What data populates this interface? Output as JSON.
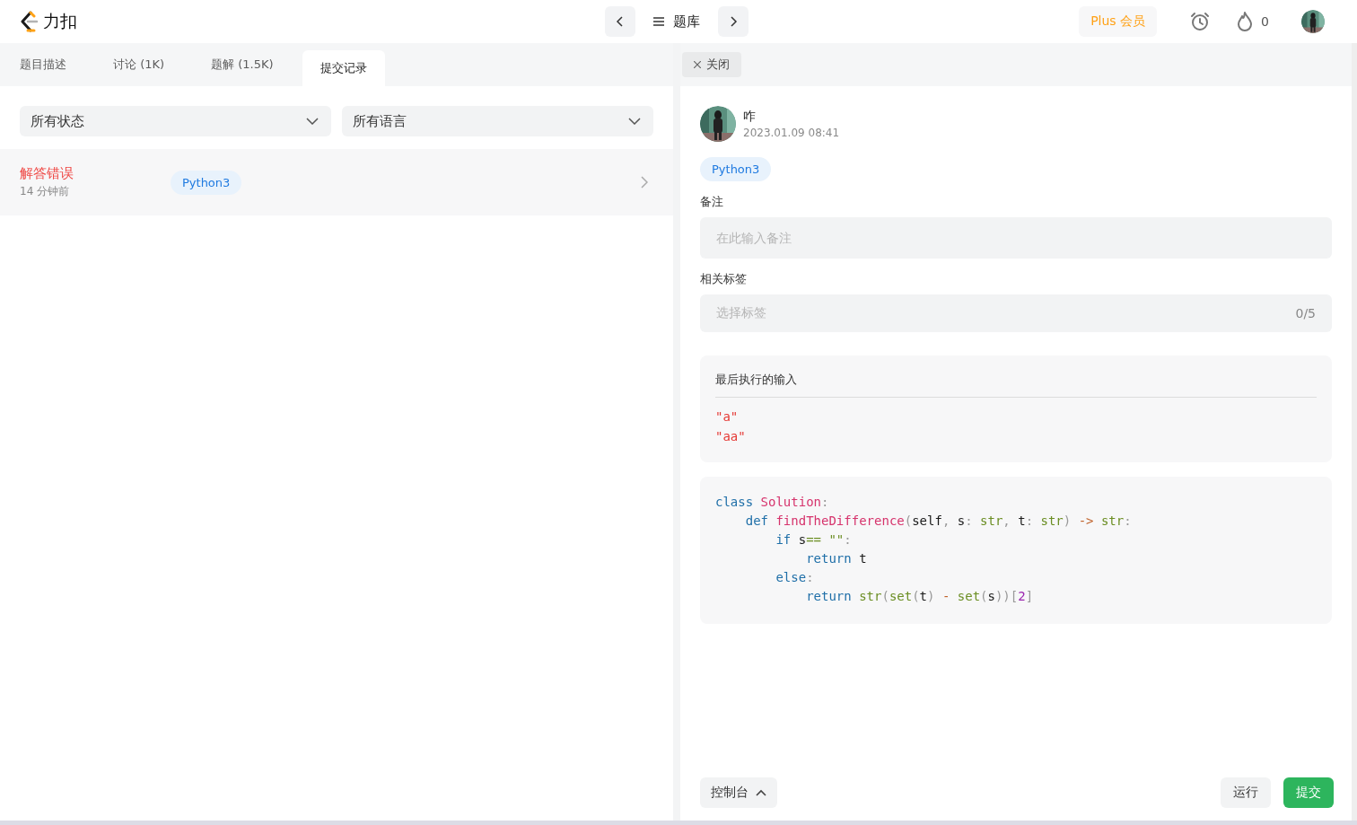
{
  "header": {
    "logo_text": "力扣",
    "nav_label": "题库",
    "plus_label": "Plus 会员",
    "streak_count": "0",
    "avatar": {
      "kind": "picture"
    }
  },
  "tabs": [
    {
      "label": "题目描述",
      "selected": false
    },
    {
      "label": "讨论 (1K)",
      "selected": false
    },
    {
      "label": "题解 (1.5K)",
      "selected": false
    },
    {
      "label": "提交记录",
      "selected": true
    }
  ],
  "filters": [
    {
      "value": "所有状态"
    },
    {
      "value": "所有语言"
    }
  ],
  "submissions": [
    {
      "status": "解答错误",
      "accepted": false,
      "time": "14 分钟前",
      "language": "Python3"
    }
  ],
  "detail": {
    "close_label": "关闭",
    "user_name": "咋",
    "avatar": {
      "kind": "picture"
    },
    "timestamp": "2023.01.09 08:41",
    "language": "Python3",
    "note_label": "备注",
    "note_placeholder": "在此输入备注",
    "tags_label": "相关标签",
    "tags_placeholder": "选择标签",
    "tags_count": "0/5",
    "last_input_title": "最后执行的输入",
    "last_input_lines": [
      "\"a\"",
      "\"aa\""
    ],
    "code_lines": [
      [
        {
          "kind": "kw",
          "text": "class"
        },
        {
          "kind": "name",
          "text": " Solution"
        },
        {
          "kind": "punct",
          "text": ":"
        }
      ],
      [
        {
          "kind": "kw",
          "text": "    def"
        },
        {
          "kind": "name",
          "text": " findTheDifference"
        },
        {
          "kind": "punct",
          "text": "("
        },
        {
          "kind": "plain",
          "text": "self"
        },
        {
          "kind": "punct",
          "text": ", "
        },
        {
          "kind": "plain",
          "text": "s"
        },
        {
          "kind": "punct",
          "text": ": "
        },
        {
          "kind": "builtin",
          "text": "str"
        },
        {
          "kind": "punct",
          "text": ", "
        },
        {
          "kind": "plain",
          "text": "t"
        },
        {
          "kind": "punct",
          "text": ": "
        },
        {
          "kind": "builtin",
          "text": "str"
        },
        {
          "kind": "punct",
          "text": ") "
        },
        {
          "kind": "op",
          "text": "->"
        },
        {
          "kind": "builtin",
          "text": " str"
        },
        {
          "kind": "punct",
          "text": ":"
        }
      ],
      [
        {
          "kind": "kw",
          "text": "        if"
        },
        {
          "kind": "plain",
          "text": " s"
        },
        {
          "kind": "builtin",
          "text": "=="
        },
        {
          "kind": "builtin",
          "text": " \"\""
        },
        {
          "kind": "punct",
          "text": ":"
        }
      ],
      [
        {
          "kind": "kw",
          "text": "            return"
        },
        {
          "kind": "plain",
          "text": " t"
        }
      ],
      [
        {
          "kind": "kw",
          "text": "        else"
        },
        {
          "kind": "punct",
          "text": ":"
        }
      ],
      [
        {
          "kind": "kw",
          "text": "            return"
        },
        {
          "kind": "builtin",
          "text": " str"
        },
        {
          "kind": "punct",
          "text": "("
        },
        {
          "kind": "builtin",
          "text": "set"
        },
        {
          "kind": "punct",
          "text": "("
        },
        {
          "kind": "plain",
          "text": "t"
        },
        {
          "kind": "punct",
          "text": ") "
        },
        {
          "kind": "op",
          "text": "-"
        },
        {
          "kind": "builtin",
          "text": " set"
        },
        {
          "kind": "punct",
          "text": "("
        },
        {
          "kind": "plain",
          "text": "s"
        },
        {
          "kind": "punct",
          "text": "))["
        },
        {
          "kind": "num",
          "text": "2"
        },
        {
          "kind": "punct",
          "text": "]"
        }
      ]
    ]
  },
  "footer": {
    "console_label": "控制台",
    "run_label": "运行",
    "submit_label": "提交"
  }
}
